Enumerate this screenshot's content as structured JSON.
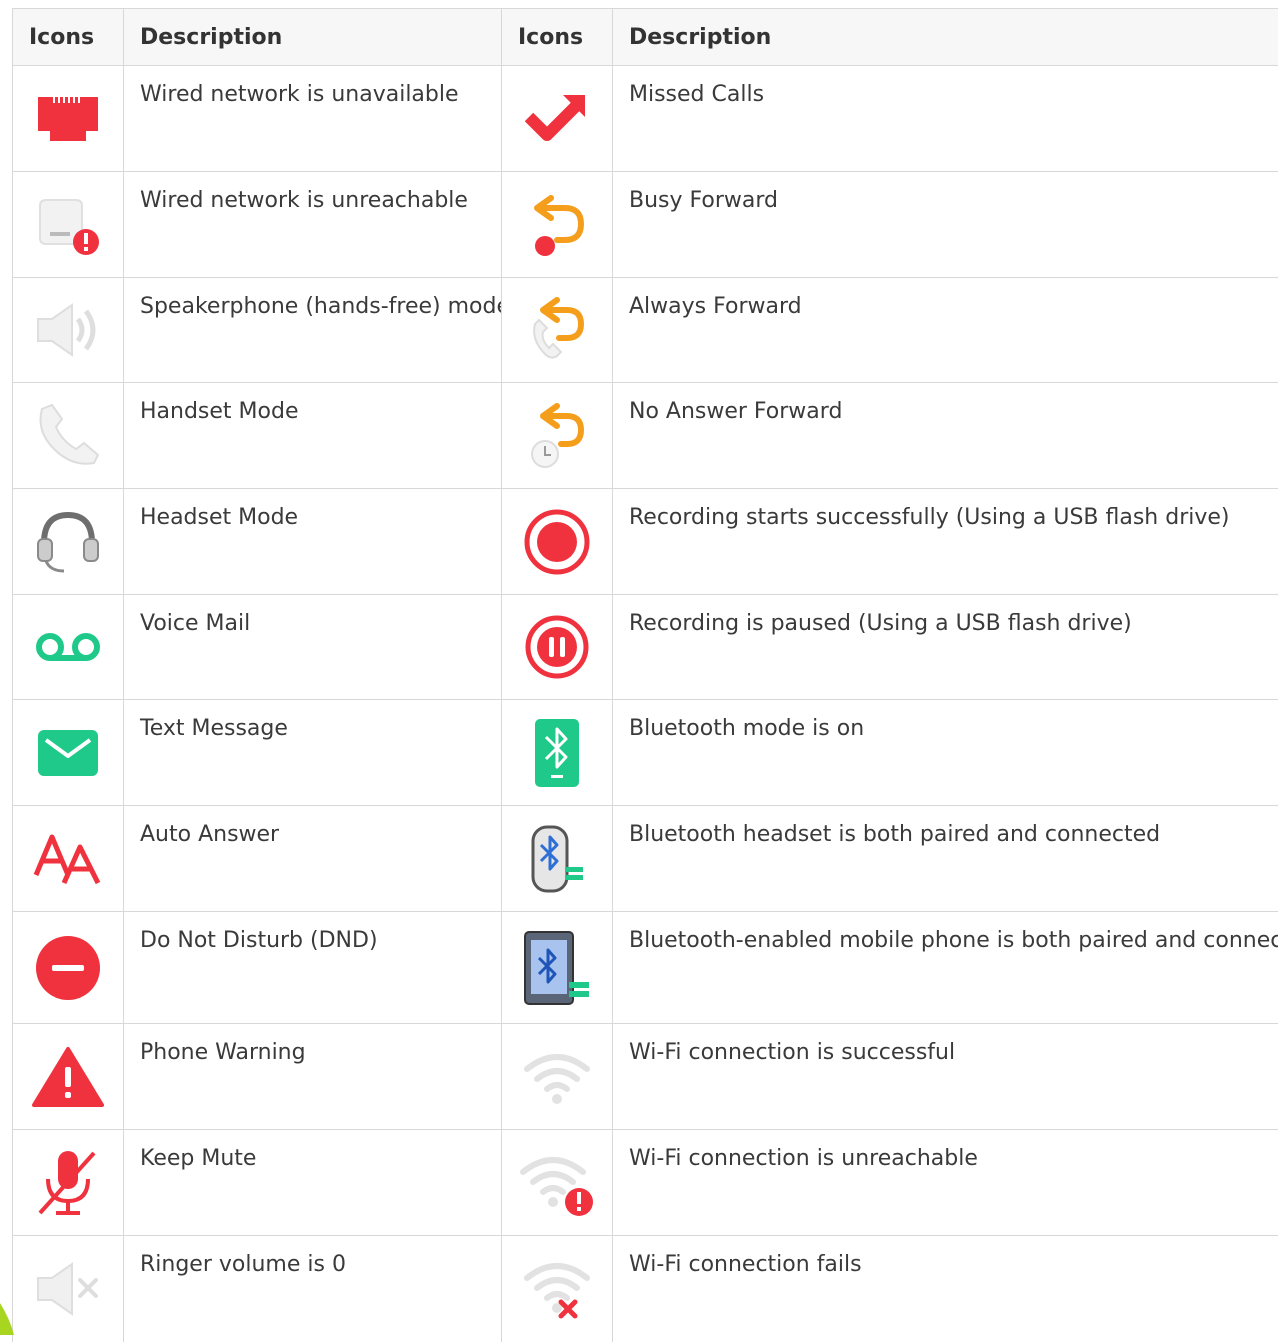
{
  "table": {
    "headers": [
      "Icons",
      "Description",
      "Icons",
      "Description"
    ],
    "rows": [
      {
        "left": {
          "icon": "wired-network-unavailable-icon",
          "description": "Wired network is unavailable"
        },
        "right": {
          "icon": "missed-calls-icon",
          "description": "Missed Calls"
        }
      },
      {
        "left": {
          "icon": "wired-network-unreachable-icon",
          "description": "Wired network is unreachable"
        },
        "right": {
          "icon": "busy-forward-icon",
          "description": "Busy Forward"
        }
      },
      {
        "left": {
          "icon": "speakerphone-icon",
          "description": "Speakerphone (hands-free) mode"
        },
        "right": {
          "icon": "always-forward-icon",
          "description": "Always Forward"
        }
      },
      {
        "left": {
          "icon": "handset-icon",
          "description": "Handset Mode"
        },
        "right": {
          "icon": "no-answer-forward-icon",
          "description": "No Answer Forward"
        }
      },
      {
        "left": {
          "icon": "headset-icon",
          "description": "Headset Mode"
        },
        "right": {
          "icon": "recording-start-icon",
          "description": "Recording starts successfully (Using a USB flash drive)"
        }
      },
      {
        "left": {
          "icon": "voicemail-icon",
          "description": "Voice Mail"
        },
        "right": {
          "icon": "recording-paused-icon",
          "description": "Recording is paused (Using a USB flash drive)"
        }
      },
      {
        "left": {
          "icon": "text-message-icon",
          "description": "Text Message"
        },
        "right": {
          "icon": "bluetooth-on-icon",
          "description": "Bluetooth mode is on"
        }
      },
      {
        "left": {
          "icon": "auto-answer-icon",
          "description": "Auto Answer"
        },
        "right": {
          "icon": "bluetooth-headset-icon",
          "description": "Bluetooth headset is both paired and connected"
        }
      },
      {
        "left": {
          "icon": "dnd-icon",
          "description": "Do Not Disturb (DND)"
        },
        "right": {
          "icon": "bluetooth-mobile-icon",
          "description": "Bluetooth-enabled mobile phone is both paired and connected"
        }
      },
      {
        "left": {
          "icon": "phone-warning-icon",
          "description": "Phone Warning"
        },
        "right": {
          "icon": "wifi-success-icon",
          "description": "Wi-Fi connection is successful"
        }
      },
      {
        "left": {
          "icon": "keep-mute-icon",
          "description": "Keep Mute"
        },
        "right": {
          "icon": "wifi-unreachable-icon",
          "description": "Wi-Fi connection is unreachable"
        }
      },
      {
        "left": {
          "icon": "ringer-volume-zero-icon",
          "description": "Ringer volume is 0"
        },
        "right": {
          "icon": "wifi-fails-icon",
          "description": "Wi-Fi connection fails"
        }
      }
    ]
  },
  "colors": {
    "red": "#f0323e",
    "orange": "#f59e1b",
    "green": "#1ec98a",
    "grey": "#d9d9d9",
    "dark_grey": "#6e6e6e",
    "header_bg": "#f7f7f7",
    "border": "#d8d8d8"
  }
}
